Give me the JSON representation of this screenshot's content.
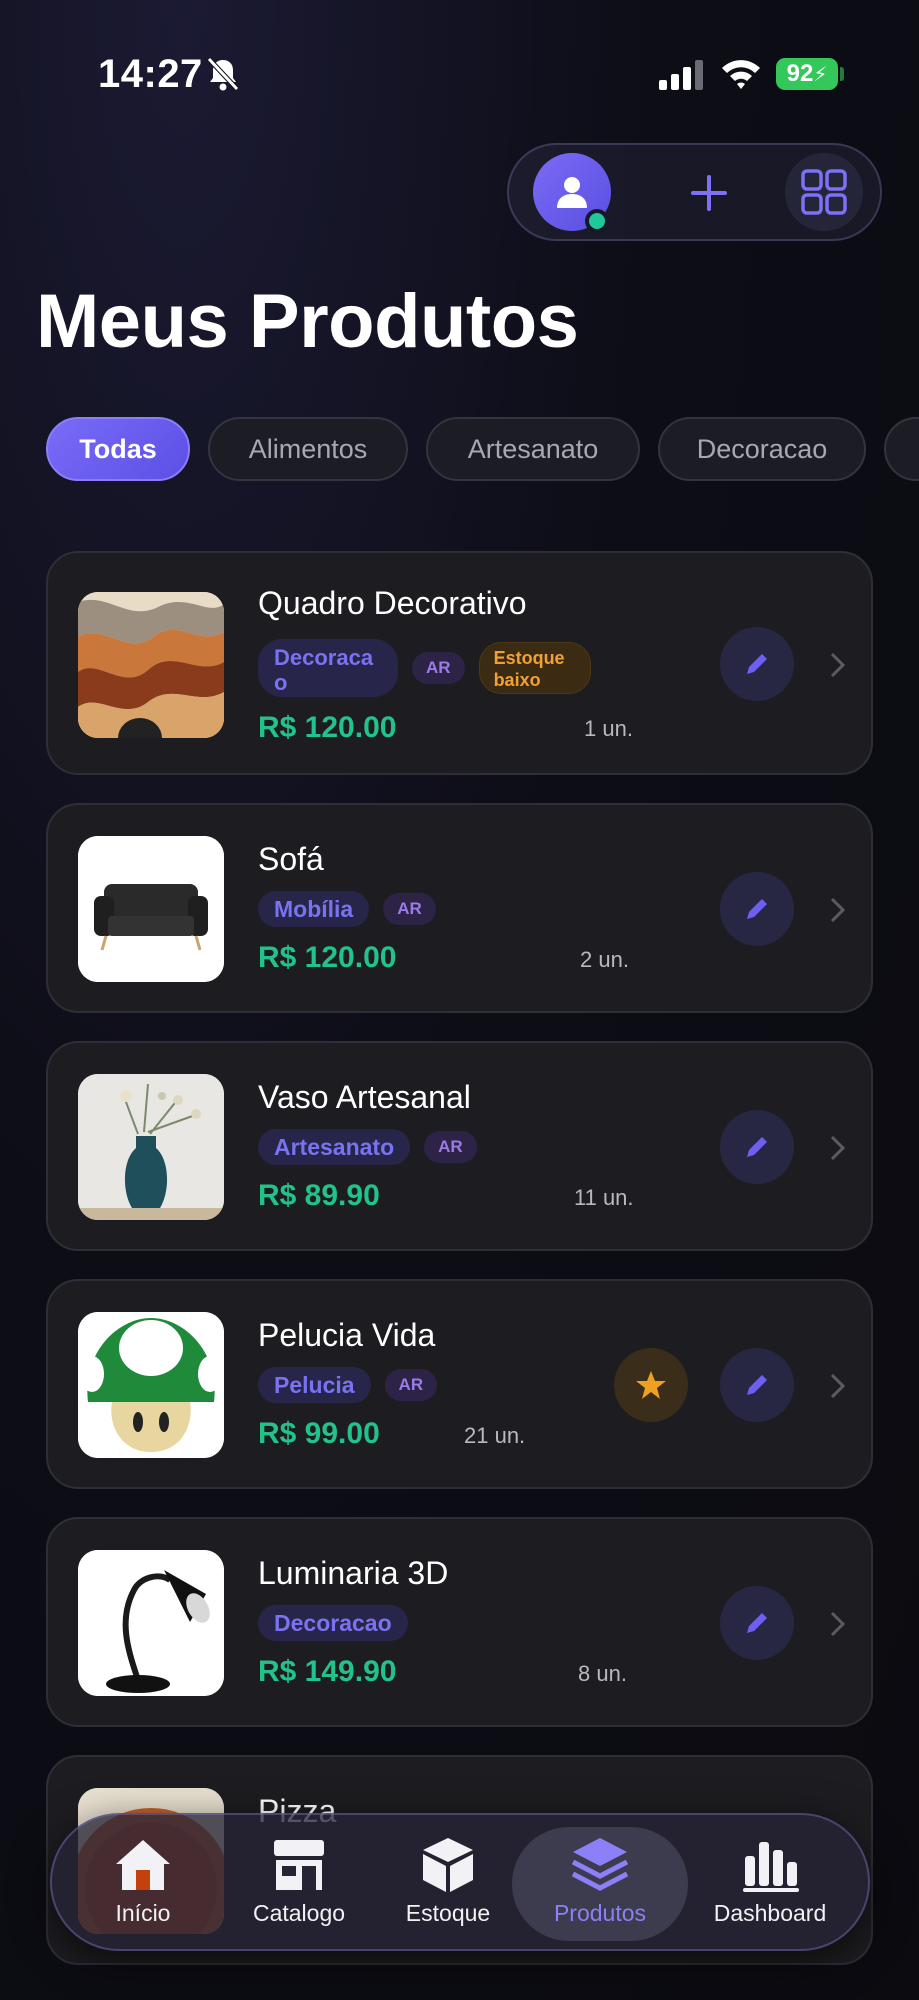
{
  "status": {
    "time": "14:27",
    "battery": "92"
  },
  "header": {
    "title": "Meus Produtos"
  },
  "filters": [
    "Todas",
    "Alimentos",
    "Artesanato",
    "Decoracao"
  ],
  "products": [
    {
      "name": "Quadro Decorativo",
      "category": "Decoracao",
      "ar": "AR",
      "stock_badge": "Estoque baixo",
      "price": "R$ 120.00",
      "qty": "1 un."
    },
    {
      "name": "Sofá",
      "category": "Mobília",
      "ar": "AR",
      "price": "R$ 120.00",
      "qty": "2 un."
    },
    {
      "name": "Vaso Artesanal",
      "category": "Artesanato",
      "ar": "AR",
      "price": "R$ 89.90",
      "qty": "11 un."
    },
    {
      "name": "Pelucia Vida",
      "category": "Pelucia",
      "ar": "AR",
      "price": "R$ 99.00",
      "qty": "21 un.",
      "featured": true
    },
    {
      "name": "Luminaria 3D",
      "category": "Decoracao",
      "price": "R$ 149.90",
      "qty": "8 un."
    },
    {
      "name": "Pizza"
    }
  ],
  "nav": [
    {
      "label": "Início",
      "icon": "home-icon"
    },
    {
      "label": "Catalogo",
      "icon": "store-icon"
    },
    {
      "label": "Estoque",
      "icon": "box-icon"
    },
    {
      "label": "Produtos",
      "icon": "layers-icon",
      "active": true
    },
    {
      "label": "Dashboard",
      "icon": "bar-chart-icon"
    }
  ],
  "colors": {
    "accent": "#6d5ff2",
    "price": "#22c38a",
    "warning": "#f0a034",
    "online": "#1fc79a"
  }
}
